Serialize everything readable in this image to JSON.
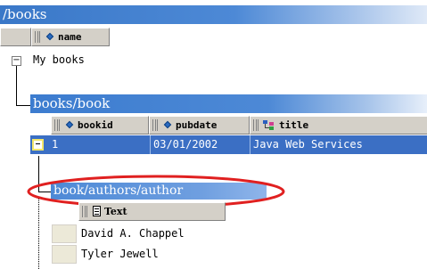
{
  "root": {
    "title": "/books",
    "column": "name",
    "value": "My books"
  },
  "book": {
    "title": "books/book",
    "columns": [
      "bookid",
      "pubdate",
      "title"
    ],
    "row": [
      "1",
      "03/01/2002",
      "Java Web Services"
    ]
  },
  "authors": {
    "title": "book/authors/author",
    "column": "Text",
    "rows": [
      "David A. Chappel",
      "Tyler Jewell"
    ]
  },
  "colors": {
    "header_blue": "#4d89d6",
    "highlight_ellipse": "#e02020",
    "selected_row": "#3b6fc4"
  },
  "icons": [
    "collapse-icon",
    "attribute-icon",
    "element-icon",
    "text-node-icon"
  ]
}
